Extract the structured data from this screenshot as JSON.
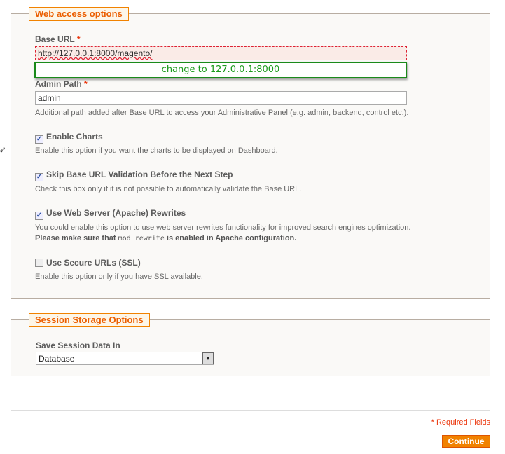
{
  "web_access": {
    "legend": "Web access options",
    "base_url": {
      "label": "Base URL",
      "required": "*",
      "value": "http://127.0.0.1:8000/magento/"
    },
    "annotation": "change to 127.0.0.1:8000",
    "admin_path": {
      "label": "Admin Path",
      "required": "*",
      "value": "admin",
      "help": "Additional path added after Base URL to access your Administrative Panel (e.g. admin, backend, control etc.)."
    },
    "options": [
      {
        "label": "Enable Charts",
        "checked": true,
        "help": "Enable this option if you want the charts to be displayed on Dashboard."
      },
      {
        "label": "Skip Base URL Validation Before the Next Step",
        "checked": true,
        "help": "Check this box only if it is not possible to automatically validate the Base URL."
      },
      {
        "label": "Use Web Server (Apache) Rewrites",
        "checked": true,
        "help": "You could enable this option to use web server rewrites functionality for improved search engines optimization.",
        "note_pre": "Please make sure that ",
        "note_code": "mod_rewrite",
        "note_post": " is enabled in Apache configuration."
      },
      {
        "label": "Use Secure URLs (SSL)",
        "checked": false,
        "help": "Enable this option only if you have SSL available."
      }
    ]
  },
  "session": {
    "legend": "Session Storage Options",
    "label": "Save Session Data In",
    "value": "Database"
  },
  "footer": {
    "required_note": "* Required Fields",
    "continue": "Continue"
  },
  "colors": {
    "accent": "#f18200",
    "annotation": "#1a8a1a"
  }
}
